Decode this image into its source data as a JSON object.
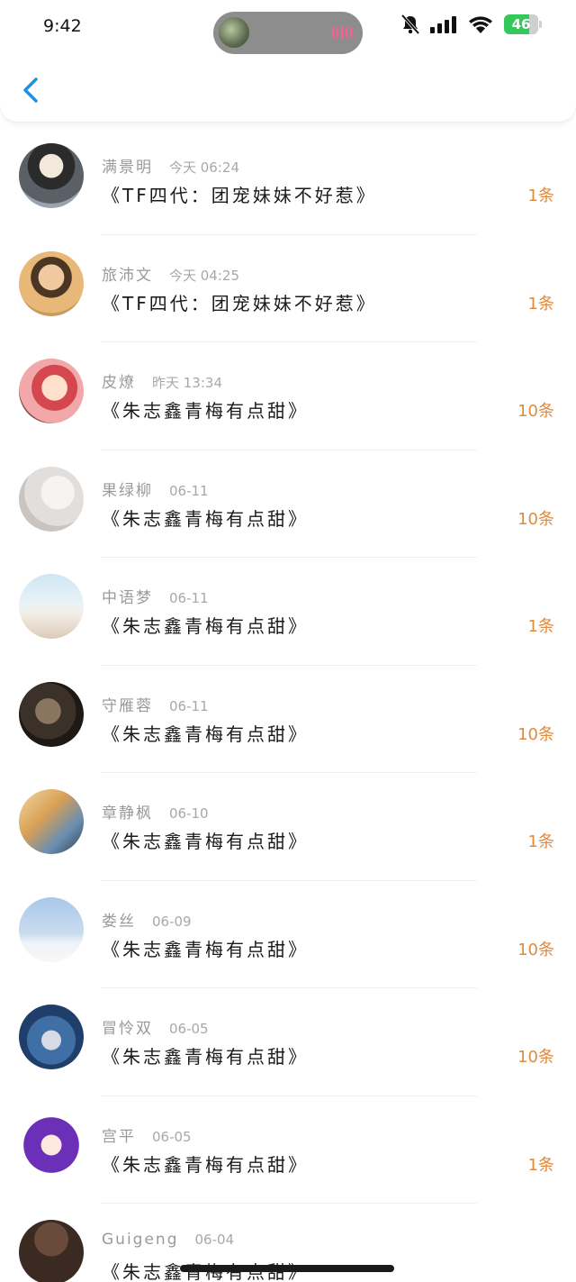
{
  "status_bar": {
    "time": "9:42",
    "battery": "46",
    "icons": [
      "bell-slash-icon",
      "signal-icon",
      "wifi-icon",
      "battery-icon"
    ]
  },
  "nav": {
    "back_icon": "chevron-left-icon",
    "accent": "#1e90e6"
  },
  "colors": {
    "count": "#e08a3c",
    "name": "#9a9a9a"
  },
  "messages": [
    {
      "name": "满景明",
      "date": "今天 06:24",
      "title": "《TF四代：团宠妹妹不好惹》",
      "count": "1条"
    },
    {
      "name": "旅沛文",
      "date": "今天 04:25",
      "title": "《TF四代：团宠妹妹不好惹》",
      "count": "1条"
    },
    {
      "name": "皮燎",
      "date": "昨天 13:34",
      "title": "《朱志鑫青梅有点甜》",
      "count": "10条"
    },
    {
      "name": "果绿柳",
      "date": "06-11",
      "title": "《朱志鑫青梅有点甜》",
      "count": "10条"
    },
    {
      "name": "中语梦",
      "date": "06-11",
      "title": "《朱志鑫青梅有点甜》",
      "count": "1条"
    },
    {
      "name": "守雁蓉",
      "date": "06-11",
      "title": "《朱志鑫青梅有点甜》",
      "count": "10条"
    },
    {
      "name": "章静枫",
      "date": "06-10",
      "title": "《朱志鑫青梅有点甜》",
      "count": "1条"
    },
    {
      "name": "娄丝",
      "date": "06-09",
      "title": "《朱志鑫青梅有点甜》",
      "count": "10条"
    },
    {
      "name": "冒怜双",
      "date": "06-05",
      "title": "《朱志鑫青梅有点甜》",
      "count": "10条"
    },
    {
      "name": "宫平",
      "date": "06-05",
      "title": "《朱志鑫青梅有点甜》",
      "count": "1条"
    },
    {
      "name": "Guigeng",
      "date": "06-04",
      "title": "《朱志鑫青梅有点甜》",
      "count": ""
    }
  ]
}
